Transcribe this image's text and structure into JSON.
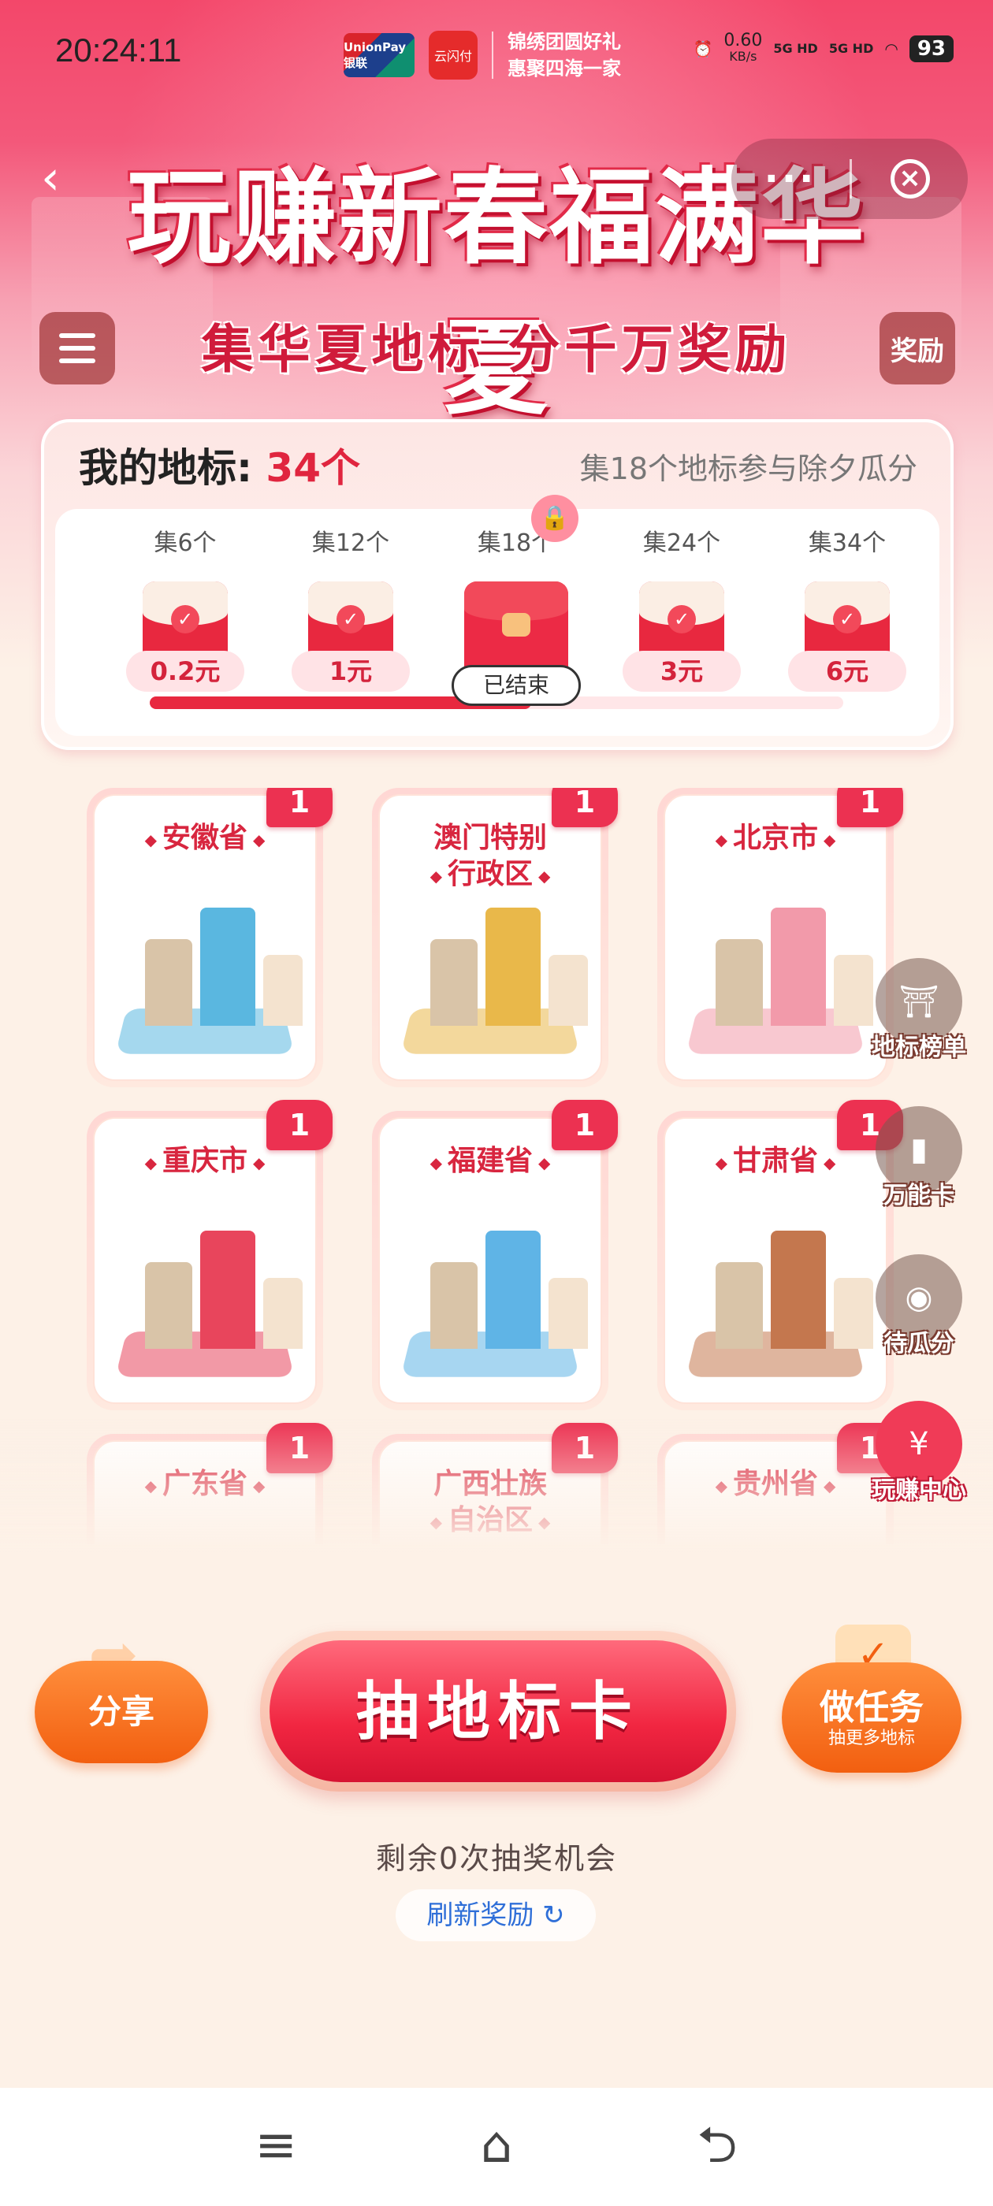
{
  "status_bar": {
    "time": "20:24:11",
    "net_speed": "0.60",
    "net_unit": "KB/s",
    "sim1": "5G HD",
    "sim2": "5G HD",
    "battery": "93"
  },
  "brand": {
    "unionpay_label": "UnionPay 银联",
    "yunshanfu_label": "云闪付",
    "slogan_line1": "锦绣团圆好礼",
    "slogan_line2": "惠聚四海一家"
  },
  "header": {
    "title": "玩赚新春福满华夏",
    "subtitle": "集华夏地标  分千万奖励",
    "more_label": "···",
    "reward_label": "奖励",
    "back_icon": "chevron-left-icon"
  },
  "my_landmarks": {
    "label": "我的地标:",
    "count": "34个",
    "hint": "集18个地标参与除夕瓜分",
    "progress": 0.55,
    "tiers": [
      {
        "label": "集6个",
        "amount": "0.2元",
        "status": "claimed"
      },
      {
        "label": "集12个",
        "amount": "1元",
        "status": "claimed"
      },
      {
        "label": "集18个",
        "amount": "已结束",
        "status": "ended"
      },
      {
        "label": "集24个",
        "amount": "3元",
        "status": "claimed"
      },
      {
        "label": "集34个",
        "amount": "6元",
        "status": "claimed"
      }
    ]
  },
  "provinces": [
    {
      "name": "安徽省",
      "count": "1",
      "accent": "#5ab7e0"
    },
    {
      "name": "澳门特别行政区",
      "line1": "澳门特别",
      "line2": "行政区",
      "count": "1",
      "accent": "#e9b84a"
    },
    {
      "name": "北京市",
      "count": "1",
      "accent": "#f29aaa"
    },
    {
      "name": "重庆市",
      "count": "1",
      "accent": "#e8455c"
    },
    {
      "name": "福建省",
      "count": "1",
      "accent": "#5fb4e6"
    },
    {
      "name": "甘肃省",
      "count": "1",
      "accent": "#c4774e"
    },
    {
      "name": "广东省",
      "count": "1",
      "accent": "#e8455c"
    },
    {
      "name": "广西壮族自治区",
      "line1": "广西壮族",
      "line2": "自治区",
      "count": "1",
      "accent": "#e8455c"
    },
    {
      "name": "贵州省",
      "count": "1",
      "accent": "#e8455c"
    }
  ],
  "side_buttons": [
    {
      "label": "地标榜单",
      "icon": "pagoda-icon"
    },
    {
      "label": "万能卡",
      "icon": "card-icon"
    },
    {
      "label": "待瓜分",
      "icon": "money-bag-icon"
    },
    {
      "label": "玩赚中心",
      "icon": "red-envelope-icon"
    }
  ],
  "actions": {
    "share_label": "分享",
    "draw_label": "抽地标卡",
    "task_title": "做任务",
    "task_sub": "抽更多地标",
    "remain_text": "剩余0次抽奖机会",
    "refresh_label": "刷新奖励 ↻"
  },
  "colors": {
    "brand_red": "#e8283f",
    "orange": "#f25f10",
    "link_blue": "#2f6fd8"
  }
}
